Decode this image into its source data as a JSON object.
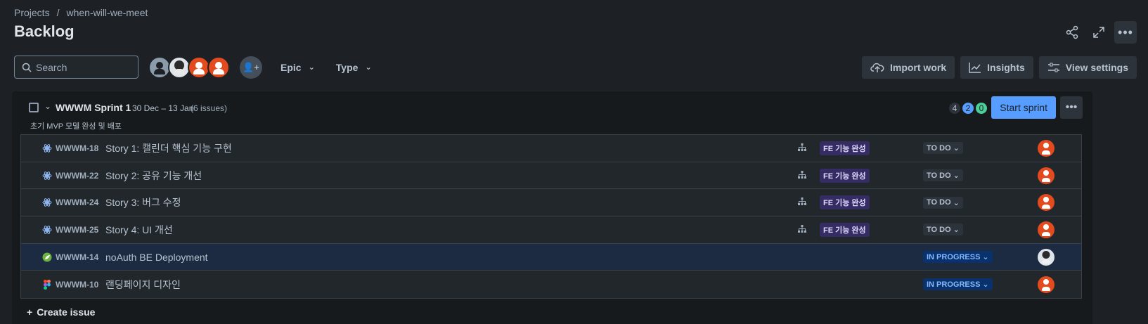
{
  "breadcrumb": {
    "root": "Projects",
    "separator": "/",
    "project": "when-will-we-meet"
  },
  "page_title": "Backlog",
  "toolbar": {
    "search_placeholder": "Search",
    "epic_filter": "Epic",
    "type_filter": "Type",
    "import_label": "Import work",
    "insights_label": "Insights",
    "view_settings_label": "View settings"
  },
  "sprint": {
    "name": "WWWM Sprint 1",
    "dates": "30 Dec – 13 Jan",
    "issue_count": "(6 issues)",
    "goal": "초기 MVP 모델 완성 및 배포",
    "todo_count": "4",
    "in_progress_count": "2",
    "done_count": "0",
    "start_label": "Start sprint"
  },
  "issues": [
    {
      "key": "WWWM-18",
      "summary": "Story 1: 캘린더 핵심 기능 구현",
      "epic": "FE 기능 완성",
      "status": "TO DO"
    },
    {
      "key": "WWWM-22",
      "summary": "Story 2: 공유 기능 개선",
      "epic": "FE 기능 완성",
      "status": "TO DO"
    },
    {
      "key": "WWWM-24",
      "summary": "Story 3: 버그 수정",
      "epic": "FE 기능 완성",
      "status": "TO DO"
    },
    {
      "key": "WWWM-25",
      "summary": "Story 4: UI 개선",
      "epic": "FE 기능 완성",
      "status": "TO DO"
    },
    {
      "key": "WWWM-14",
      "summary": "noAuth BE Deployment",
      "epic": "",
      "status": "IN PROGRESS"
    },
    {
      "key": "WWWM-10",
      "summary": "랜딩페이지 디자인",
      "epic": "",
      "status": "IN PROGRESS"
    }
  ],
  "create_issue": "Create issue",
  "colors": {
    "accent": "#579dff",
    "epic_bg": "#352c63",
    "avatar_red": "#e34a1e"
  }
}
